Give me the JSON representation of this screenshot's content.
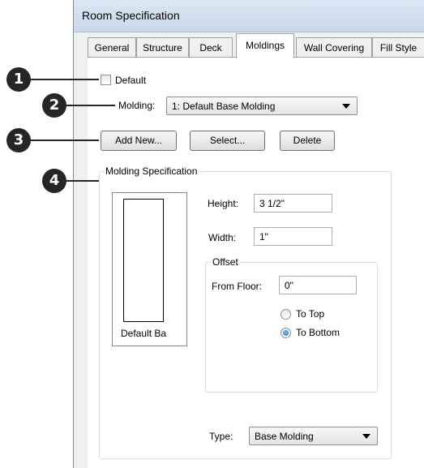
{
  "window": {
    "title": "Room Specification"
  },
  "tabs": [
    "General",
    "Structure",
    "Deck",
    "Moldings",
    "Wall Covering",
    "Fill Style"
  ],
  "active_tab": "Moldings",
  "default_checkbox": {
    "label": "Default",
    "checked": false
  },
  "molding_select": {
    "label": "Molding:",
    "value": "1:  Default Base Molding"
  },
  "buttons": {
    "add_new": "Add New...",
    "select": "Select...",
    "delete": "Delete"
  },
  "spec_group": {
    "label": "Molding Specification",
    "preview_label": "Default Ba",
    "height": {
      "label": "Height:",
      "value": "3 1/2\""
    },
    "width": {
      "label": "Width:",
      "value": "1\""
    },
    "offset": {
      "label": "Offset",
      "from_floor": {
        "label": "From Floor:",
        "value": "0\""
      },
      "options": [
        {
          "label": "To Top",
          "selected": false
        },
        {
          "label": "To Bottom",
          "selected": true
        }
      ]
    },
    "type": {
      "label": "Type:",
      "value": "Base Molding"
    }
  },
  "callouts": [
    "1",
    "2",
    "3",
    "4"
  ],
  "colors": {
    "callout": "#262626",
    "titlebar": "#c9d8ea",
    "radio_selected": "#1f6fc2"
  }
}
